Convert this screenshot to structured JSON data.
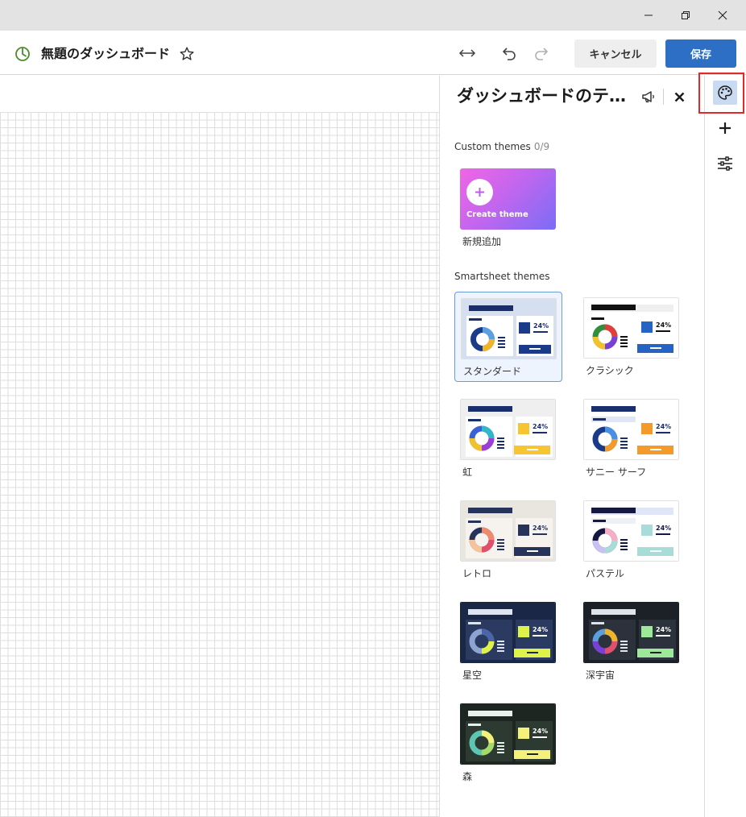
{
  "window": {
    "minimize_icon": "minimize-icon",
    "restore_icon": "restore-icon",
    "close_icon": "close-icon"
  },
  "header": {
    "title": "無題のダッシュボード",
    "cancel_label": "キャンセル",
    "save_label": "保存",
    "accent": "#2c6fc4"
  },
  "panel": {
    "title": "ダッシュボードのテーマ",
    "custom_section_label": "Custom themes",
    "custom_section_count": "0/9",
    "create_text": "Create theme",
    "create_caption": "新規追加",
    "smartsheet_section_label": "Smartsheet themes",
    "percent_text": "24%",
    "themes": [
      {
        "label": "スタンダード",
        "selected": true
      },
      {
        "label": "クラシック",
        "selected": false
      },
      {
        "label": "虹",
        "selected": false
      },
      {
        "label": "サニー サーフ",
        "selected": false
      },
      {
        "label": "レトロ",
        "selected": false
      },
      {
        "label": "パステル",
        "selected": false
      },
      {
        "label": "星空",
        "selected": false
      },
      {
        "label": "深宇宙",
        "selected": false
      },
      {
        "label": "森",
        "selected": false
      }
    ]
  },
  "rail": {
    "items": [
      {
        "name": "palette-icon",
        "active": true
      },
      {
        "name": "plus-icon",
        "active": false
      },
      {
        "name": "sliders-icon",
        "active": false
      }
    ]
  }
}
